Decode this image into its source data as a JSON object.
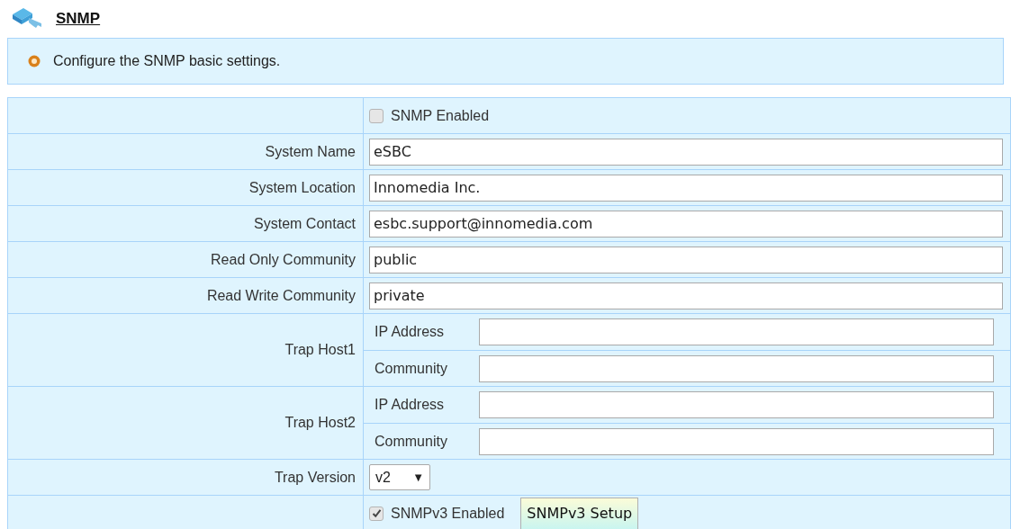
{
  "title": "SNMP",
  "info": "Configure the SNMP basic settings.",
  "rows": [
    {
      "kind": "checkbox",
      "label": "SNMP Enabled",
      "checked": false
    },
    {
      "kind": "text",
      "label": "System Name",
      "value": "eSBC"
    },
    {
      "kind": "text",
      "label": "System Location",
      "value": "Innomedia Inc."
    },
    {
      "kind": "text",
      "label": "System Contact",
      "value": "esbc.support@innomedia.com"
    },
    {
      "kind": "text",
      "label": "Read Only Community",
      "value": "public"
    },
    {
      "kind": "text",
      "label": "Read Write Community",
      "value": "private"
    },
    {
      "kind": "host",
      "label": "Trap Host1",
      "fields": [
        {
          "label": "IP Address"
        },
        {
          "label": "Community"
        }
      ]
    },
    {
      "kind": "host",
      "label": "Trap Host2",
      "fields": [
        {
          "label": "IP Address"
        },
        {
          "label": "Community"
        }
      ]
    },
    {
      "kind": "select",
      "label": "Trap Version",
      "value": "v2",
      "arrow": "▼"
    },
    {
      "kind": "v3",
      "checkbox_label": "SNMPv3 Enabled",
      "checked": true,
      "button": "SNMPv3 Setup"
    }
  ]
}
